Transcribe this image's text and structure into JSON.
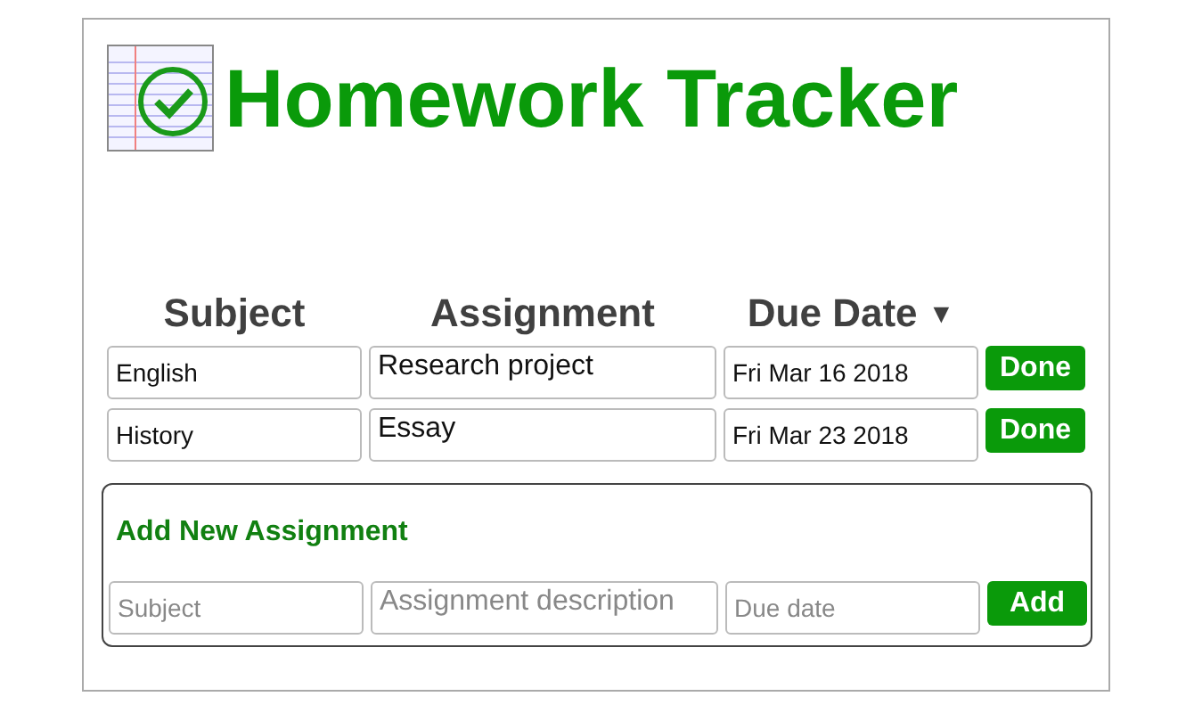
{
  "title": "Homework Tracker",
  "columns": [
    {
      "label": "Subject"
    },
    {
      "label": "Assignment"
    },
    {
      "label": "Due Date",
      "sort_indicator": "▼"
    }
  ],
  "rows": [
    {
      "subject": "English",
      "assignment": "Research project",
      "due": "Fri Mar 16 2018",
      "action": "Done"
    },
    {
      "subject": "History",
      "assignment": "Essay",
      "due": "Fri Mar 23 2018",
      "action": "Done"
    }
  ],
  "add_form": {
    "heading": "Add New Assignment",
    "subject_placeholder": "Subject",
    "assignment_placeholder": "Assignment description",
    "due_placeholder": "Due date",
    "button": "Add"
  }
}
